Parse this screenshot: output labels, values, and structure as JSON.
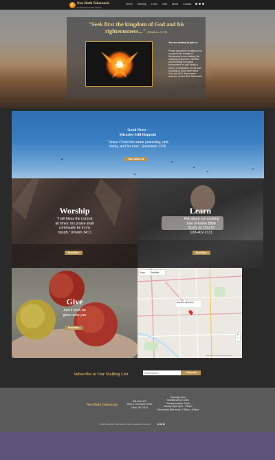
{
  "header": {
    "brand_name": "New Birth Tabernacle",
    "brand_sub": "United Pentecostal Church",
    "nav": [
      "Home",
      "Worship",
      "Learn",
      "Give",
      "About",
      "Contact"
    ],
    "social_icons": [
      "facebook-icon",
      "twitter-icon",
      "instagram-icon"
    ]
  },
  "hero": {
    "quote_line1": "\"Seek first the kingdom of God and his",
    "quote_line2": "righteousness...\"",
    "quote_ref": "(Matthew 6:33)",
    "invited_heading": "You are invited to join us",
    "invite_text": "Please accept this invitation to be our guest this Sunday or Wednesday for an exciting, life-changing experience. Whether you're looking for a great environment for your family, a source of inspiration, or just have a longing to know more about God, you WILL find a warm welcome at New Birth Tabernacle."
  },
  "news": {
    "title_line1": "Good News -",
    "title_line2": "Miracles Still Happen!",
    "verse_line1": "\"Jesus Christ the same yesterday, and",
    "verse_line2": "today, and for ever.\" (Hebrews 13:8)",
    "button": "More About Us"
  },
  "worship": {
    "title": "Worship",
    "verse_lines": [
      "\"I will bless the Lord at",
      "all times: his praise shall",
      "continually be in my",
      "mouth.\" (Psalm 34:1)"
    ],
    "button": "Read More"
  },
  "learn": {
    "title": "Learn",
    "text_lines": [
      "Ask about our exciting",
      "free in-home Bible",
      "Study on Church",
      "918-402-2131"
    ],
    "button": "Read More"
  },
  "give": {
    "title": "Give",
    "text_lines": [
      "And it shall be",
      "given unto you"
    ],
    "button": "Read More"
  },
  "map": {
    "tabs": [
      "Map",
      "Satellite"
    ],
    "pin_label": "New Birth Tabernacle",
    "credit": "Map data ©2018 Google  Terms of Use"
  },
  "subscribe": {
    "title": "Subscribe to Our Mailing List",
    "email_placeholder": "Email Address",
    "button": "Subscribe"
  },
  "footer": {
    "brand": "New Birth Tabernacle",
    "contact_lines": [
      "918-402-2131",
      "3616 E. Tecumseh Street",
      "Tulsa, OK 74115"
    ],
    "hours_lines": [
      "Opening Hours",
      "Sunday school: 10am",
      "Sunday worship: 11am",
      "Sunday night: 6pm - 7:30pm",
      "Wednesday Bible study: 7:30pm - 8:45pm"
    ],
    "copyright": "©2023 New Birth Tabernacle. Proudly created with Wix.com"
  },
  "colors": {
    "gold": "#b9944e",
    "quote_gold": "#e9d28e",
    "footer_bg": "#5a5a5a",
    "bottom_band": "#5b5478"
  }
}
